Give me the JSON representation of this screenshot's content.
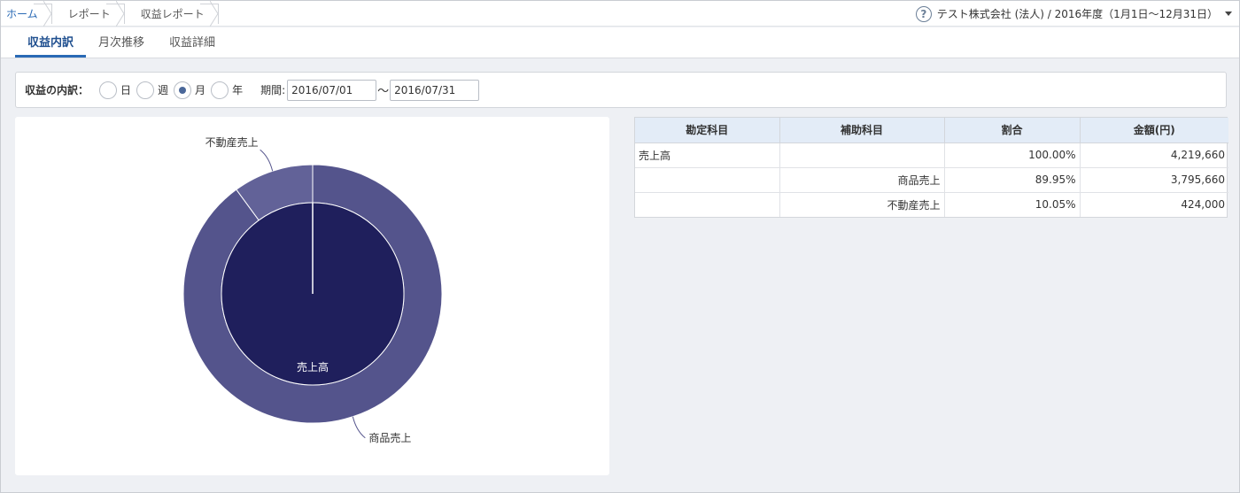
{
  "breadcrumb": [
    {
      "label": "ホーム",
      "link": true
    },
    {
      "label": "レポート",
      "link": false
    },
    {
      "label": "収益レポート",
      "link": false
    }
  ],
  "header": {
    "help_icon": "?",
    "company": "テスト株式会社 (法人) / 2016年度（1月1日〜12月31日）"
  },
  "tabs": [
    {
      "label": "収益内訳",
      "active": true
    },
    {
      "label": "月次推移",
      "active": false
    },
    {
      "label": "収益詳細",
      "active": false
    }
  ],
  "filter": {
    "label": "収益の内訳：",
    "options": [
      {
        "label": "日",
        "checked": false
      },
      {
        "label": "週",
        "checked": false
      },
      {
        "label": "月",
        "checked": true
      },
      {
        "label": "年",
        "checked": false
      }
    ],
    "period_label": "期間:",
    "start_date": "2016/07/01",
    "tilde": "〜",
    "end_date": "2016/07/31"
  },
  "table": {
    "headers": [
      "勘定科目",
      "補助科目",
      "割合",
      "金額(円)"
    ],
    "rows": [
      [
        "売上高",
        "",
        "100.00%",
        "4,219,660"
      ],
      [
        "",
        "商品売上",
        "89.95%",
        "3,795,660"
      ],
      [
        "",
        "不動産売上",
        "10.05%",
        "424,000"
      ]
    ]
  },
  "chart_data": {
    "type": "pie",
    "inner": {
      "name": "",
      "slices": [
        {
          "label": "売上高",
          "value": 4219660
        }
      ]
    },
    "outer": {
      "name": "",
      "slices": [
        {
          "label": "商品売上",
          "value": 3795660
        },
        {
          "label": "不動産売上",
          "value": 424000
        }
      ]
    },
    "colors": {
      "inner": "#1f1f5c",
      "outer_main": "#54548c",
      "outer_minor": "#626298",
      "stroke": "#ffffff"
    }
  }
}
